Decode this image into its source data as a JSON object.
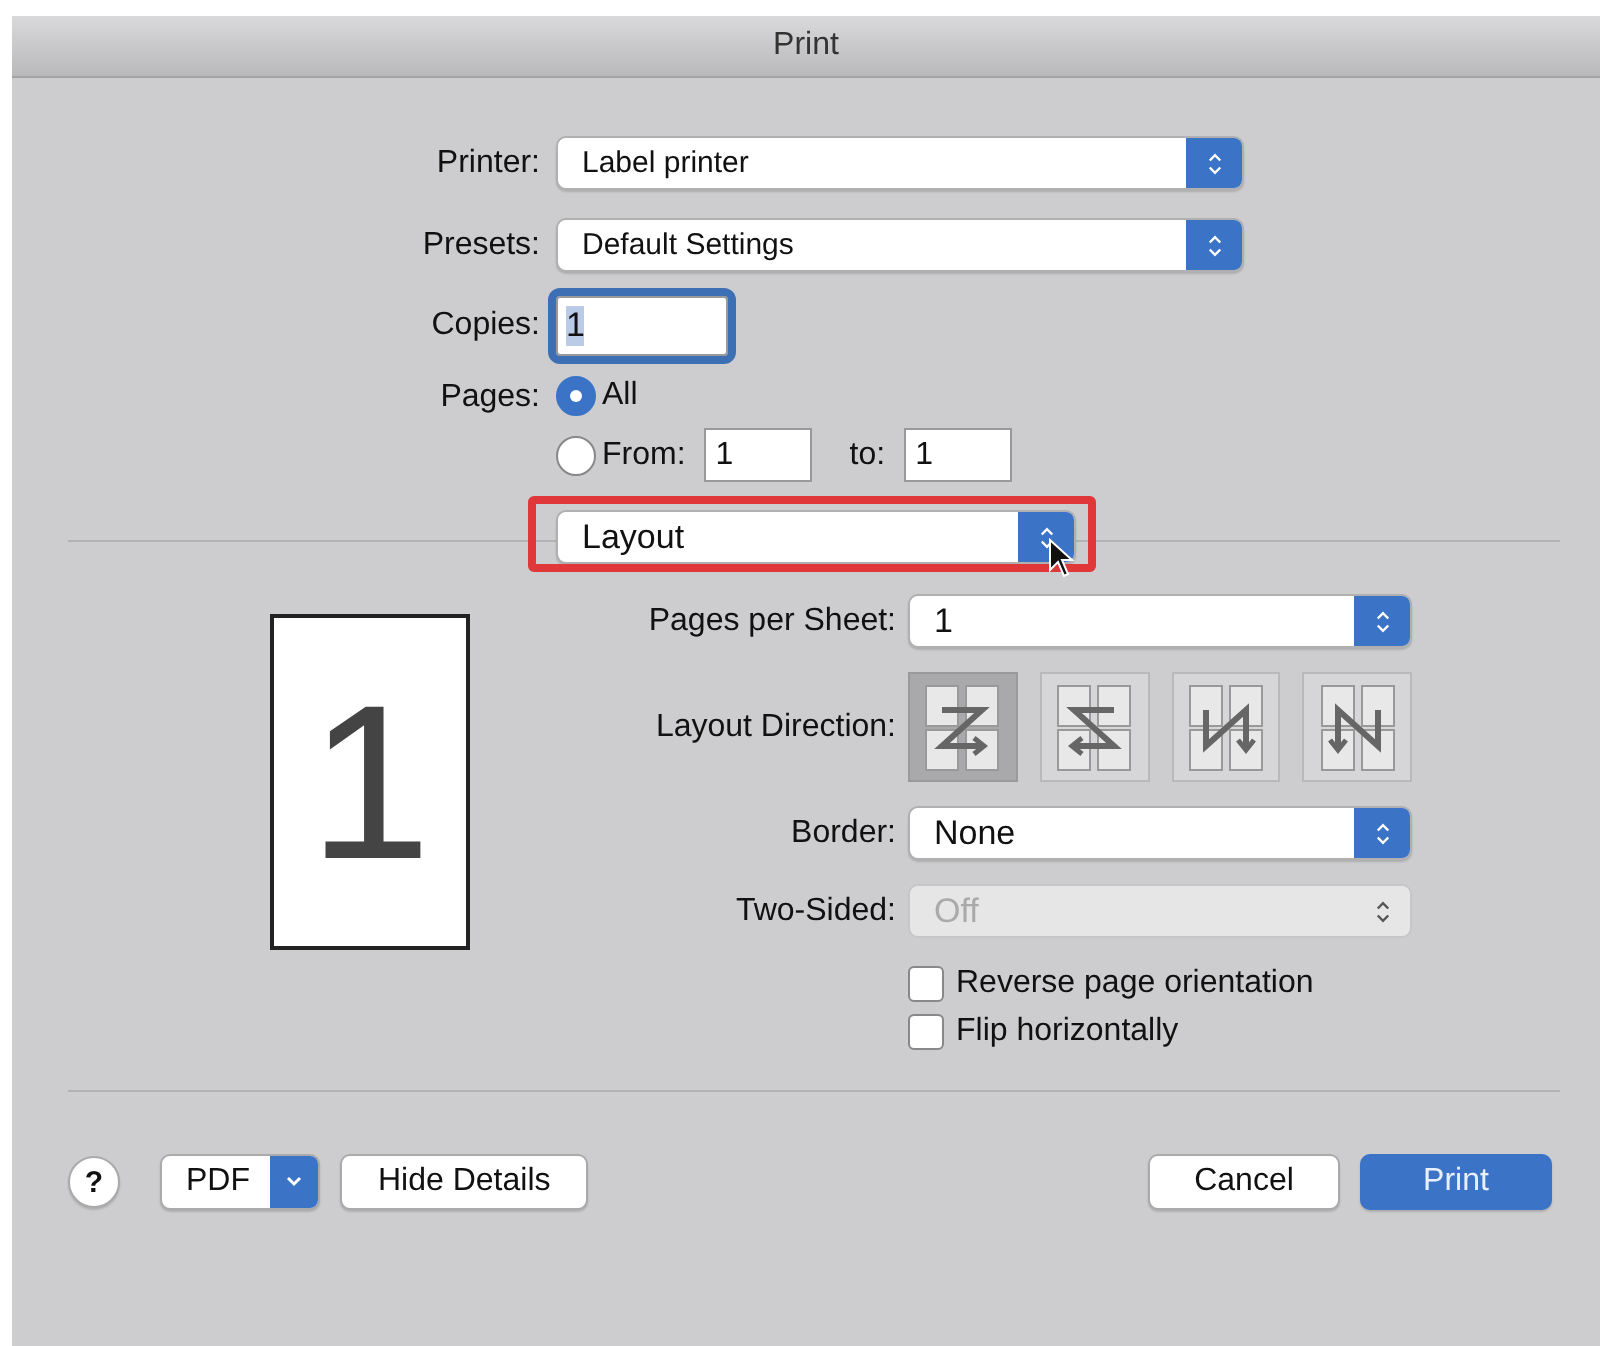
{
  "window": {
    "title": "Print"
  },
  "printer": {
    "label": "Printer:",
    "value": "Label printer"
  },
  "presets": {
    "label": "Presets:",
    "value": "Default Settings"
  },
  "copies": {
    "label": "Copies:",
    "value": "1",
    "focused": true
  },
  "pages": {
    "label": "Pages:",
    "options": [
      {
        "label": "All",
        "selected": true
      },
      {
        "label": "From:",
        "selected": false,
        "from": "1",
        "to_label": "to:",
        "to": "1"
      }
    ]
  },
  "section_menu": {
    "value": "Layout",
    "highlighted": true
  },
  "preview": {
    "page_number": "1"
  },
  "layout": {
    "pages_per_sheet": {
      "label": "Pages per Sheet:",
      "value": "1",
      "disabled": false
    },
    "direction": {
      "label": "Layout Direction:",
      "options": [
        {
          "kind": "z",
          "selected": true
        },
        {
          "kind": "reverse-z",
          "selected": false
        },
        {
          "kind": "reverse-n",
          "selected": false
        },
        {
          "kind": "n",
          "selected": false
        }
      ]
    },
    "border": {
      "label": "Border:",
      "value": "None",
      "disabled": false
    },
    "two_sided": {
      "label": "Two-Sided:",
      "value": "Off",
      "disabled": true
    },
    "checkboxes": [
      {
        "label": "Reverse page orientation",
        "checked": false
      },
      {
        "label": "Flip horizontally",
        "checked": false
      }
    ]
  },
  "buttons": [
    {
      "kind": "help",
      "label": "?"
    },
    {
      "kind": "menu",
      "label": "PDF"
    },
    {
      "kind": "push",
      "label": "Hide Details"
    },
    {
      "kind": "spacer"
    },
    {
      "kind": "push",
      "label": "Cancel"
    },
    {
      "kind": "default",
      "label": "Print"
    }
  ]
}
